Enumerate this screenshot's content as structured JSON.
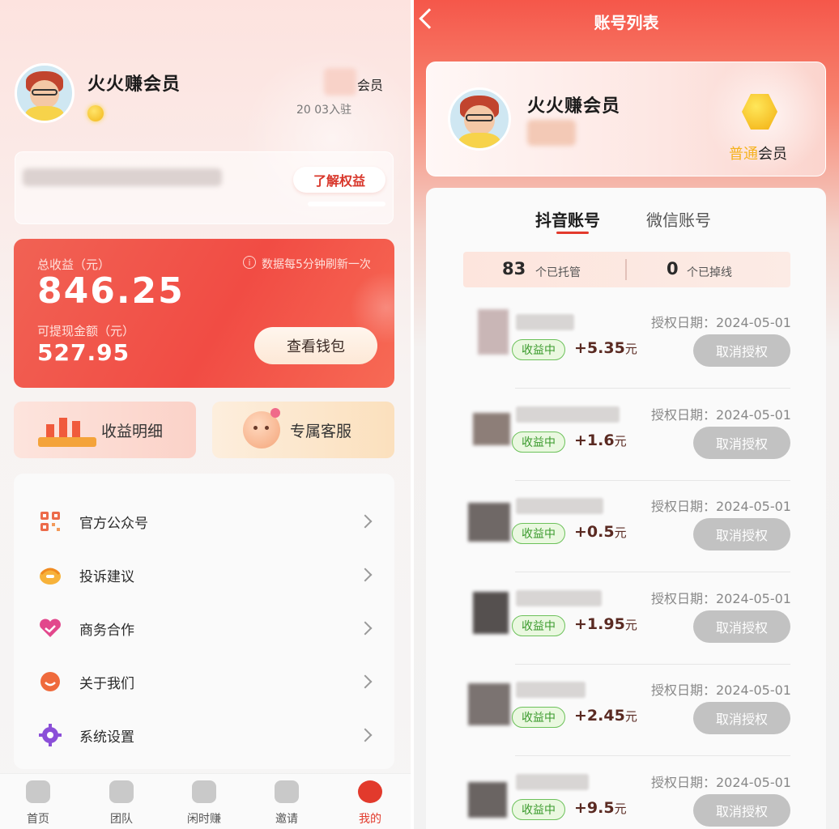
{
  "left": {
    "profile": {
      "name": "火火赚会员",
      "member_label": "会员",
      "join_date": "20 03入驻"
    },
    "benefits": {
      "button": "了解权益"
    },
    "earnings": {
      "total_label": "总收益（元）",
      "refresh_note": "数据每5分钟刷新一次",
      "total_value": "846.25",
      "withdraw_label": "可提现金额（元）",
      "withdraw_value": "527.95",
      "wallet_button": "查看钱包"
    },
    "quick": [
      {
        "label": "收益明细"
      },
      {
        "label": "专属客服"
      }
    ],
    "menu": [
      {
        "label": "官方公众号",
        "icon": "qrcode-icon"
      },
      {
        "label": "投诉建议",
        "icon": "headset-icon"
      },
      {
        "label": "商务合作",
        "icon": "handshake-icon"
      },
      {
        "label": "关于我们",
        "icon": "chat-bubble-icon"
      },
      {
        "label": "系统设置",
        "icon": "gear-icon"
      }
    ],
    "tabbar": [
      {
        "label": "首页",
        "icon": "home-icon"
      },
      {
        "label": "团队",
        "icon": "team-icon"
      },
      {
        "label": "闲时赚",
        "icon": "bag-icon"
      },
      {
        "label": "邀请",
        "icon": "envelope-icon"
      },
      {
        "label": "我的",
        "icon": "user-icon",
        "active": true
      }
    ]
  },
  "right": {
    "title": "账号列表",
    "account": {
      "name": "火火赚会员",
      "tier_prefix": "普通",
      "tier_suffix": "会员"
    },
    "tabs": [
      {
        "label": "抖音账号",
        "active": true
      },
      {
        "label": "微信账号",
        "active": false
      }
    ],
    "stats": {
      "hosted_count": "83",
      "hosted_label": "个已托管",
      "dropped_count": "0",
      "dropped_label": "个已掉线"
    },
    "rows": [
      {
        "date": "授权日期：2024-05-01",
        "status": "收益中",
        "amount": "+5.35",
        "unit": "元",
        "button": "取消授权"
      },
      {
        "date": "授权日期：2024-05-01",
        "status": "收益中",
        "amount": "+1.6",
        "unit": "元",
        "button": "取消授权"
      },
      {
        "date": "授权日期：2024-05-01",
        "status": "收益中",
        "amount": "+0.5",
        "unit": "元",
        "button": "取消授权"
      },
      {
        "date": "授权日期：2024-05-01",
        "status": "收益中",
        "amount": "+1.95",
        "unit": "元",
        "button": "取消授权"
      },
      {
        "date": "授权日期：2024-05-01",
        "status": "收益中",
        "amount": "+2.45",
        "unit": "元",
        "button": "取消授权"
      },
      {
        "date": "授权日期：2024-05-01",
        "status": "收益中",
        "amount": "+9.5",
        "unit": "元",
        "button": "取消授权"
      }
    ]
  },
  "colors": {
    "accent": "#ef4a3f",
    "tab_active": "#e23a2c",
    "status_green": "#6cc15a",
    "disabled_button": "#c2c2c2"
  }
}
